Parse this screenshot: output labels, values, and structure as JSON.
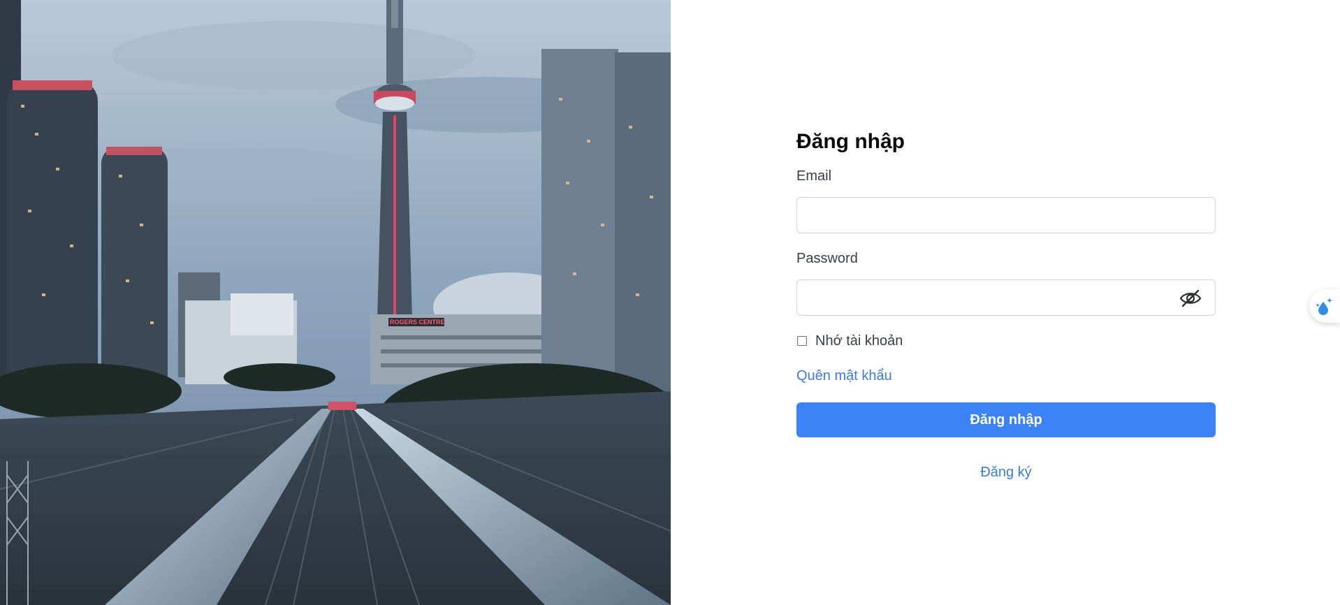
{
  "hero": {
    "sign_text": "ROGERS CENTRE"
  },
  "login": {
    "title": "Đăng nhập",
    "email_label": "Email",
    "email_value": "",
    "email_placeholder": "",
    "password_label": "Password",
    "password_value": "",
    "password_placeholder": "",
    "remember_label": "Nhớ tài khoản",
    "remember_checked": false,
    "forgot_link": "Quên mật khẩu",
    "submit_label": "Đăng nhập",
    "register_link": "Đăng ký"
  },
  "icons": {
    "password_toggle": "eye-slash-icon",
    "floating_widget": "water-drop-sparkle-icon"
  },
  "colors": {
    "primary": "#3b82f6",
    "link": "#3b7ae0",
    "title": "#0b0b0f",
    "label": "#3a3d44",
    "border": "#cfd3da"
  }
}
